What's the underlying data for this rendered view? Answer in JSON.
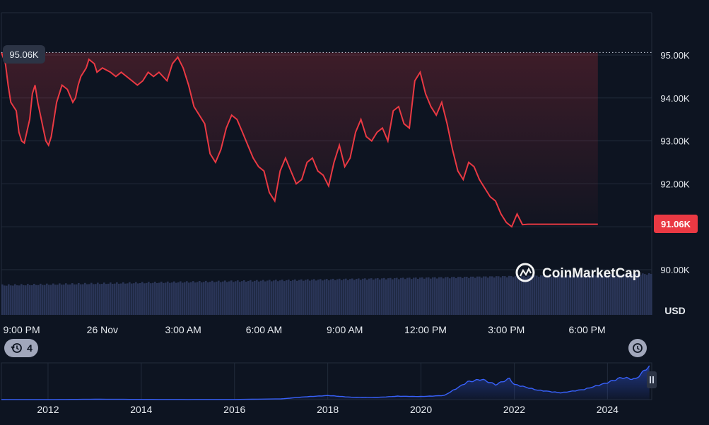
{
  "brand": {
    "name": "CoinMarketCap",
    "logo_icon": "coinmarketcap-logo-icon"
  },
  "colors": {
    "background": "#0d1421",
    "price_line": "#ea3943",
    "price_badge": "#ea3943",
    "volume": "#2a3557",
    "grid": "#222b3b",
    "axis_text": "#e7ebf0",
    "mini_line": "#3861fb",
    "button_bg": "#a1a7bb"
  },
  "controls": {
    "history_count": "4",
    "history_icon": "history-icon",
    "reset_icon": "reset-zoom-icon",
    "pause_icon": "pause-handle-icon"
  },
  "chart_data": [
    {
      "type": "line",
      "title": "",
      "unit_label": "USD",
      "open_price_label": "95.06K",
      "current_price_label": "91.06K",
      "open_price": 95060,
      "current_price": 91060,
      "ylim": [
        89000,
        96000
      ],
      "yticks": [
        90000,
        91000,
        92000,
        93000,
        94000,
        95000
      ],
      "ytick_labels": [
        "90.00K",
        "91.00K",
        "92.00K",
        "93.00K",
        "94.00K",
        "95.00K"
      ],
      "x_range_hours": [
        -3.75,
        20.4
      ],
      "xtick_hours": [
        -3,
        0,
        3,
        6,
        9,
        12,
        15,
        18
      ],
      "xtick_labels": [
        "9:00 PM",
        "26 Nov",
        "3:00 AM",
        "6:00 AM",
        "9:00 AM",
        "12:00 PM",
        "3:00 PM",
        "6:00 PM"
      ],
      "grid": true,
      "series": [
        {
          "hours": [
            -3.75,
            -3.6,
            -3.5,
            -3.4,
            -3.2,
            -3.1,
            -3,
            -2.9,
            -2.7,
            -2.6,
            -2.5,
            -2.4,
            -2.3,
            -2.2,
            -2.1,
            -2.0,
            -1.9,
            -1.7,
            -1.5,
            -1.3,
            -1.1,
            -1.0,
            -0.9,
            -0.8,
            -0.6,
            -0.5,
            -0.3,
            -0.2,
            0.0,
            0.3,
            0.5,
            0.7,
            0.9,
            1.1,
            1.3,
            1.5,
            1.7,
            1.9,
            2.1,
            2.4,
            2.6,
            2.8,
            3.0,
            3.2,
            3.4,
            3.6,
            3.8,
            4.0,
            4.2,
            4.4,
            4.6,
            4.8,
            5.0,
            5.2,
            5.4,
            5.6,
            5.8,
            6.0,
            6.2,
            6.4,
            6.6,
            6.8,
            7.0,
            7.2,
            7.4,
            7.6,
            7.8,
            8.0,
            8.2,
            8.4,
            8.6,
            8.8,
            9.0,
            9.2,
            9.4,
            9.6,
            9.8,
            10.0,
            10.2,
            10.4,
            10.6,
            10.8,
            11.0,
            11.2,
            11.4,
            11.6,
            11.8,
            12.0,
            12.2,
            12.4,
            12.6,
            12.8,
            13.0,
            13.2,
            13.4,
            13.6,
            13.8,
            14.0,
            14.2,
            14.4,
            14.6,
            14.8,
            15.0,
            15.2,
            15.4,
            15.6,
            15.8,
            16.0,
            16.2,
            16.4,
            16.6,
            16.8,
            17.0,
            17.2,
            17.4,
            17.6,
            17.8,
            18.0,
            18.2,
            18.4
          ],
          "values": [
            95060,
            94800,
            94300,
            93900,
            93700,
            93200,
            93000,
            92950,
            93500,
            94100,
            94300,
            93900,
            93600,
            93300,
            93000,
            92900,
            93100,
            93900,
            94300,
            94200,
            93900,
            94000,
            94300,
            94500,
            94700,
            94900,
            94800,
            94600,
            94700,
            94600,
            94500,
            94600,
            94500,
            94400,
            94300,
            94400,
            94600,
            94500,
            94600,
            94400,
            94800,
            94950,
            94700,
            94300,
            93800,
            93600,
            93400,
            92700,
            92500,
            92800,
            93300,
            93600,
            93500,
            93200,
            92900,
            92600,
            92400,
            92300,
            91800,
            91600,
            92300,
            92600,
            92300,
            92000,
            92100,
            92500,
            92600,
            92300,
            92200,
            91950,
            92500,
            92900,
            92400,
            92600,
            93200,
            93500,
            93100,
            93000,
            93200,
            93300,
            93000,
            93700,
            93800,
            93400,
            93300,
            94400,
            94600,
            94100,
            93800,
            93600,
            93900,
            93400,
            92800,
            92300,
            92100,
            92500,
            92400,
            92100,
            91900,
            91700,
            91600,
            91300,
            91100,
            91000,
            91300,
            91050,
            91060,
            91060,
            91060,
            91060,
            91060,
            91060,
            91060,
            91060,
            91060,
            91060,
            91060,
            91060,
            91060,
            91060
          ],
          "note": ""
        }
      ]
    },
    {
      "type": "area",
      "title": "",
      "years": [
        2011,
        2012,
        2013,
        2014,
        2015,
        2016,
        2017,
        2017.5,
        2018,
        2018.5,
        2019,
        2019.5,
        2020,
        2020.5,
        2021,
        2021.3,
        2021.6,
        2021.9,
        2022,
        2022.5,
        2023,
        2023.5,
        2024,
        2024.3,
        2024.6,
        2024.9
      ],
      "xtick_years": [
        2012,
        2014,
        2016,
        2018,
        2020,
        2022,
        2024
      ],
      "xtick_labels": [
        "2012",
        "2014",
        "2016",
        "2018",
        "2020",
        "2022",
        "2024"
      ],
      "values": [
        0.001,
        0.002,
        0.01,
        0.006,
        0.003,
        0.005,
        0.02,
        0.08,
        0.12,
        0.07,
        0.06,
        0.1,
        0.09,
        0.12,
        0.52,
        0.6,
        0.44,
        0.62,
        0.45,
        0.28,
        0.2,
        0.3,
        0.5,
        0.65,
        0.6,
        1.0
      ]
    }
  ]
}
